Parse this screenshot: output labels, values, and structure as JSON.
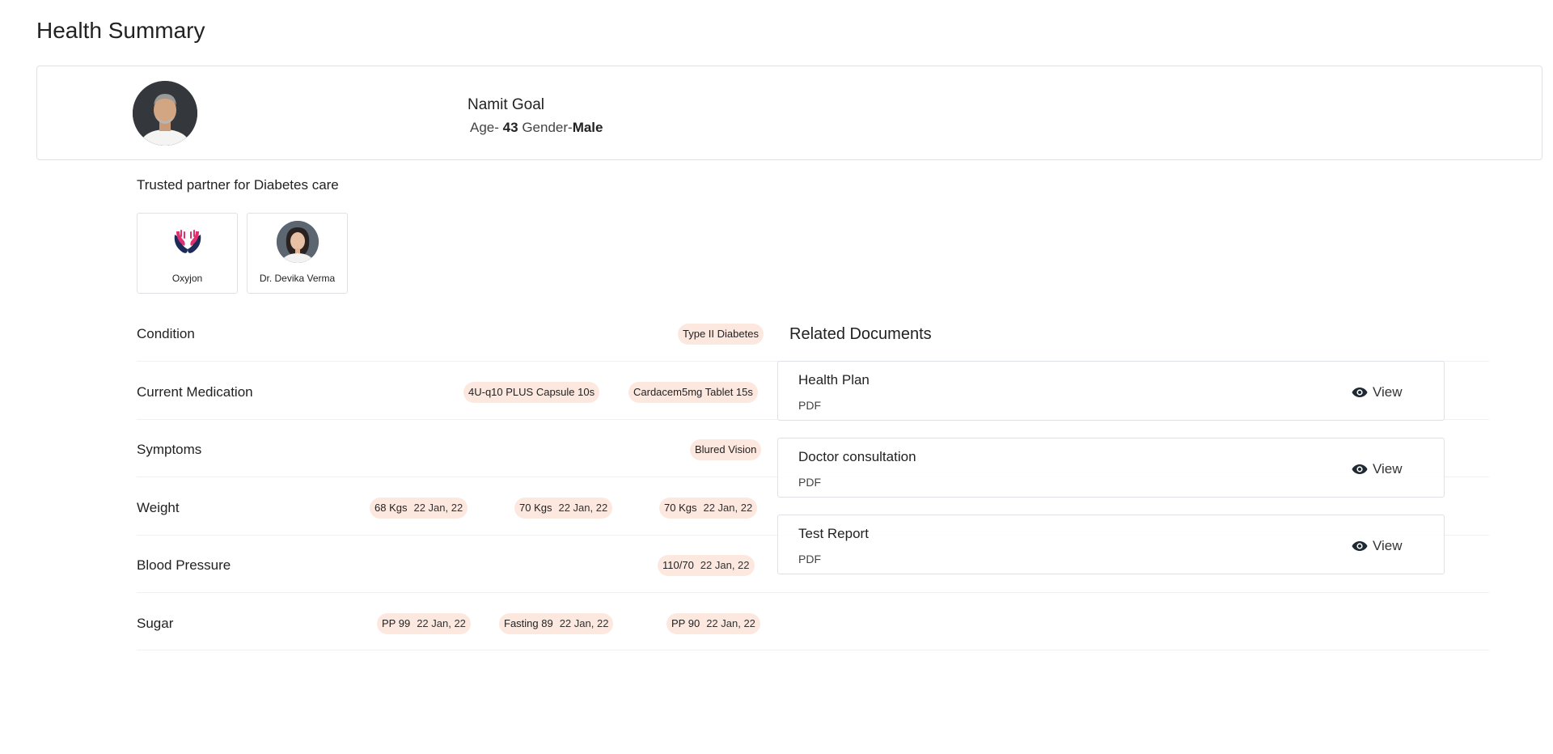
{
  "page": {
    "title": "Health Summary"
  },
  "patient": {
    "name": "Namit Goal",
    "age_label": "Age-",
    "age": "43",
    "gender_label": "Gender-",
    "gender": "Male",
    "avatar_icon": "patient-photo"
  },
  "partners": {
    "title": "Trusted partner for Diabetes care",
    "items": [
      {
        "name": "Oxyjon",
        "icon": "oxyjon-logo"
      },
      {
        "name": "Dr. Devika Verma",
        "icon": "doctor-photo"
      }
    ]
  },
  "health": {
    "condition": {
      "label": "Condition",
      "chips": [
        {
          "text": "Type II Diabetes"
        }
      ]
    },
    "medication": {
      "label": "Current Medication",
      "chips": [
        {
          "text": "4U-q10 PLUS Capsule 10s"
        },
        {
          "text": "Cardacem5mg Tablet 15s"
        }
      ]
    },
    "symptoms": {
      "label": "Symptoms",
      "chips": [
        {
          "text": "Blured Vision"
        }
      ]
    },
    "weight": {
      "label": "Weight",
      "chips": [
        {
          "value": "68 Kgs",
          "date": "22 Jan, 22"
        },
        {
          "value": "70 Kgs",
          "date": "22 Jan, 22"
        },
        {
          "value": "70 Kgs",
          "date": "22 Jan, 22"
        }
      ]
    },
    "blood_pressure": {
      "label": "Blood Pressure",
      "chips": [
        {
          "value": "110/70",
          "date": "22 Jan, 22"
        }
      ]
    },
    "sugar": {
      "label": "Sugar",
      "chips": [
        {
          "value": "PP 99",
          "date": "22 Jan, 22"
        },
        {
          "value": "Fasting 89",
          "date": "22 Jan, 22"
        },
        {
          "value": "PP 90",
          "date": "22 Jan, 22"
        }
      ]
    }
  },
  "documents": {
    "title": "Related Documents",
    "items": [
      {
        "name": "Health Plan",
        "type": "PDF",
        "action": "View"
      },
      {
        "name": "Doctor consultation",
        "type": "PDF",
        "action": "View"
      },
      {
        "name": "Test Report",
        "type": "PDF",
        "action": "View"
      }
    ]
  },
  "colors": {
    "chip_bg": "#fde8e0",
    "border": "#dee2e6",
    "logo_pink": "#e0306e",
    "logo_navy": "#1e2a5a"
  }
}
